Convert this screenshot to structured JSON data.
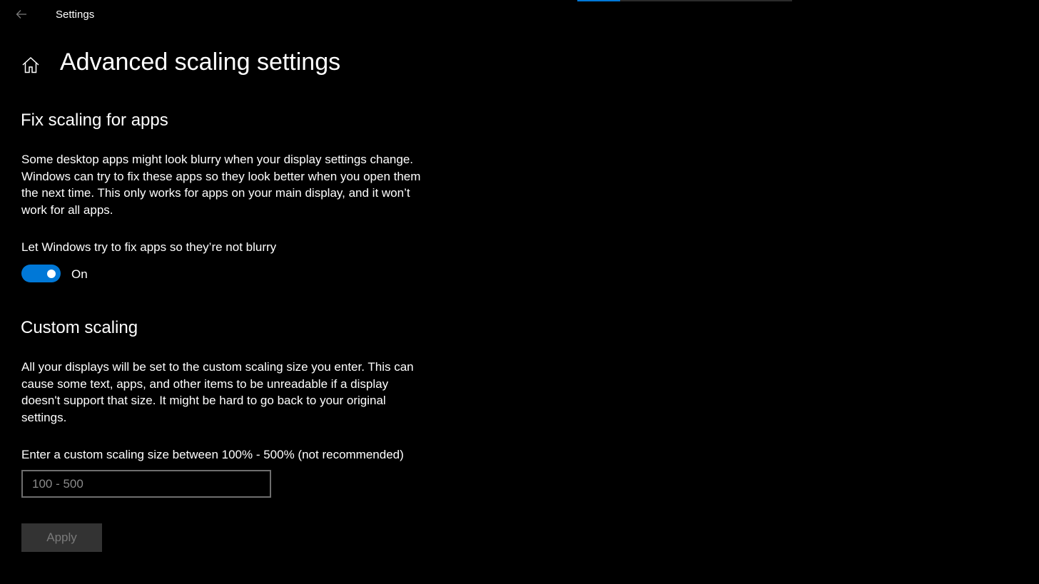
{
  "window": {
    "title": "Settings"
  },
  "page": {
    "title": "Advanced scaling settings"
  },
  "fix_scaling": {
    "heading": "Fix scaling for apps",
    "description": "Some desktop apps might look blurry when your display settings change. Windows can try to fix these apps so they look better when you open them the next time. This only works for apps on your main display, and it won’t work for all apps.",
    "toggle_label": "Let Windows try to fix apps so they’re not blurry",
    "toggle_state": "On",
    "toggle_on": true
  },
  "custom_scaling": {
    "heading": "Custom scaling",
    "description": "All your displays will be set to the custom scaling size you enter. This can cause some text, apps, and other items to be unreadable if a display doesn't support that size. It might be hard to go back to your original settings.",
    "input_label": "Enter a custom scaling size between 100% - 500% (not recommended)",
    "input_placeholder": "100 - 500",
    "input_value": "",
    "apply_label": "Apply"
  },
  "colors": {
    "background": "#000000",
    "accent": "#0078d7",
    "text": "#ffffff",
    "disabled_button_bg": "#333333",
    "disabled_button_text": "#7a7a7a"
  },
  "icons": {
    "back": "back-arrow-icon",
    "home": "home-icon"
  }
}
